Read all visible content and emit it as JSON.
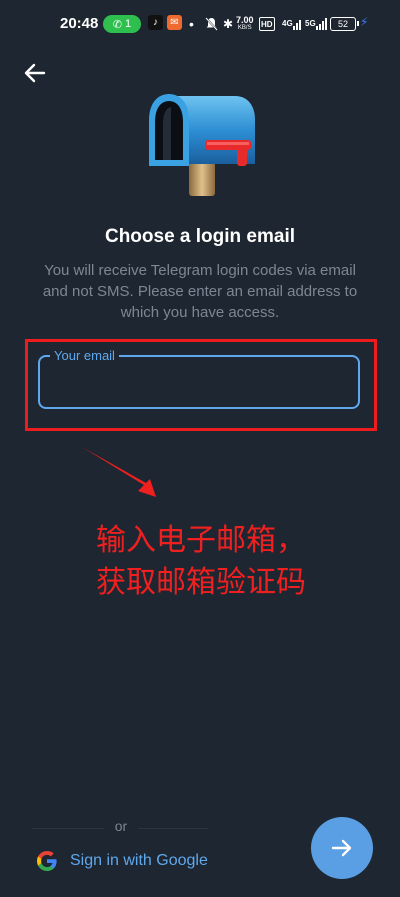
{
  "status_bar": {
    "time": "20:48",
    "call_count": "1",
    "net_speed_top": "7.00",
    "net_speed_bottom": "KB/S",
    "hd_label": "HD",
    "signal_1": "4G",
    "signal_2": "5G",
    "battery": "52"
  },
  "header": {
    "title": "Choose a login email",
    "subtitle": "You will receive Telegram login codes via email and not SMS. Please enter an email address to which you have access."
  },
  "email": {
    "label": "Your email",
    "value": "",
    "placeholder": ""
  },
  "annotation": {
    "line1": "输入电子邮箱，",
    "line2": "获取邮箱验证码",
    "color": "#ee2020"
  },
  "footer": {
    "or_text": "or",
    "google_label": "Sign in with Google"
  },
  "colors": {
    "background": "#1e2631",
    "accent": "#5fa8ee",
    "fab": "#5a9ee3",
    "highlight": "#ee1c1c"
  }
}
